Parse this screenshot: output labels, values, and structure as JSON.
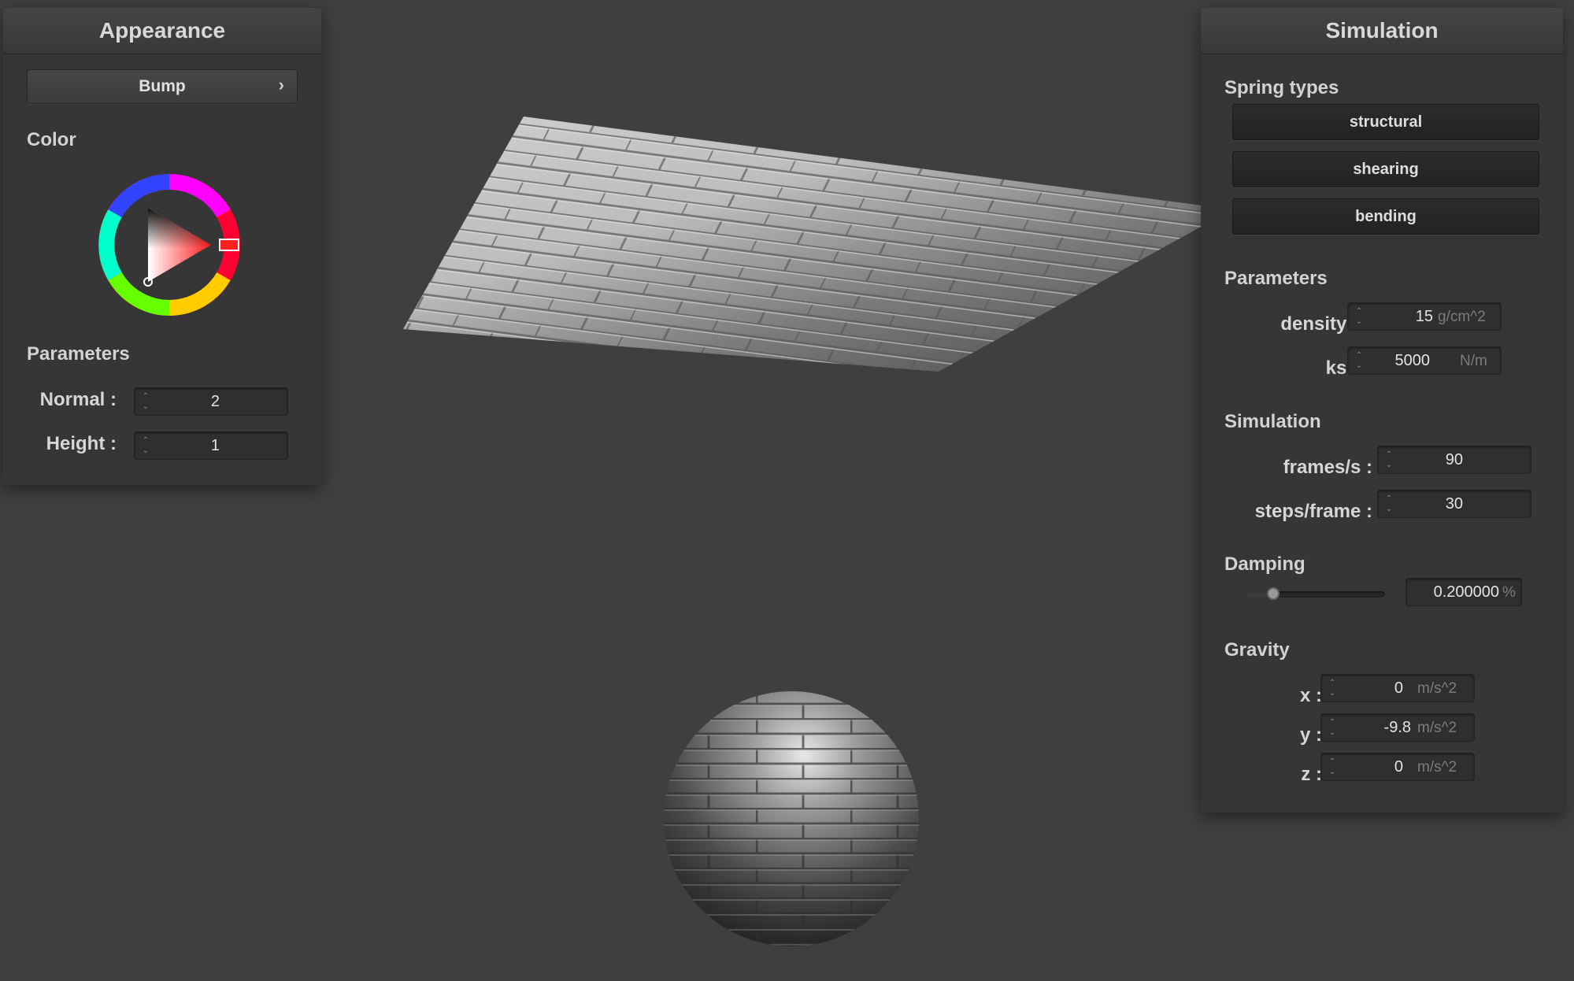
{
  "appearance": {
    "title": "Appearance",
    "shader_button": "Bump",
    "shader_chevron": "›",
    "color_title": "Color",
    "params_title": "Parameters",
    "normal": {
      "label": "Normal :",
      "value": "2"
    },
    "height": {
      "label": "Height :",
      "value": "1"
    }
  },
  "simulation": {
    "title": "Simulation",
    "spring_types_title": "Spring types",
    "springs": [
      "structural",
      "shearing",
      "bending"
    ],
    "params_title": "Parameters",
    "density": {
      "label": "density :",
      "value": "15",
      "unit": "g/cm^2"
    },
    "ks": {
      "label": "ks :",
      "value": "5000",
      "unit": "N/m"
    },
    "sim_title": "Simulation",
    "fps": {
      "label": "frames/s :",
      "value": "90"
    },
    "steps": {
      "label": "steps/frame :",
      "value": "30"
    },
    "damping_title": "Damping",
    "damping": {
      "value": "0.200000",
      "unit": "%",
      "fraction": 0.2
    },
    "gravity_title": "Gravity",
    "gx": {
      "label": "x :",
      "value": "0",
      "unit": "m/s^2"
    },
    "gy": {
      "label": "y :",
      "value": "-9.8",
      "unit": "m/s^2"
    },
    "gz": {
      "label": "z :",
      "value": "0",
      "unit": "m/s^2"
    }
  },
  "spinner_glyph": "⌃⌄",
  "colors": {
    "background": "#3f3f3f",
    "panel": "#363636",
    "selected_color": "#ff2020"
  }
}
